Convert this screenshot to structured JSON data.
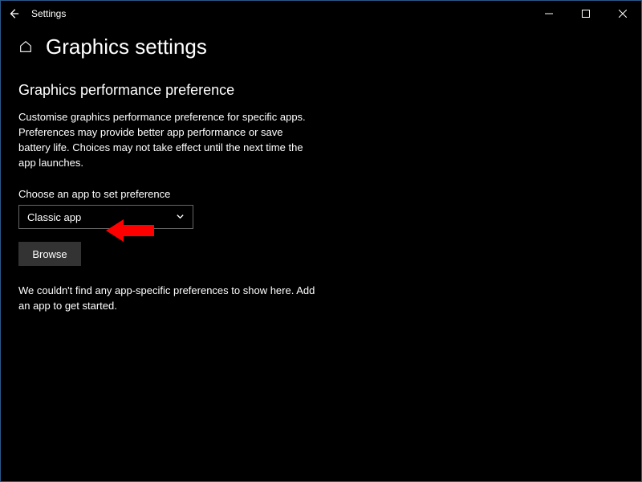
{
  "titlebar": {
    "app_name": "Settings"
  },
  "page": {
    "title": "Graphics settings"
  },
  "section": {
    "heading": "Graphics performance preference",
    "description": "Customise graphics performance preference for specific apps. Preferences may provide better app performance or save battery life. Choices may not take effect until the next time the app launches.",
    "choose_label": "Choose an app to set preference",
    "dropdown_value": "Classic app",
    "browse_label": "Browse",
    "empty_message": "We couldn't find any app-specific preferences to show here. Add an app to get started."
  },
  "annotation": {
    "arrow_color": "#ff0000"
  }
}
